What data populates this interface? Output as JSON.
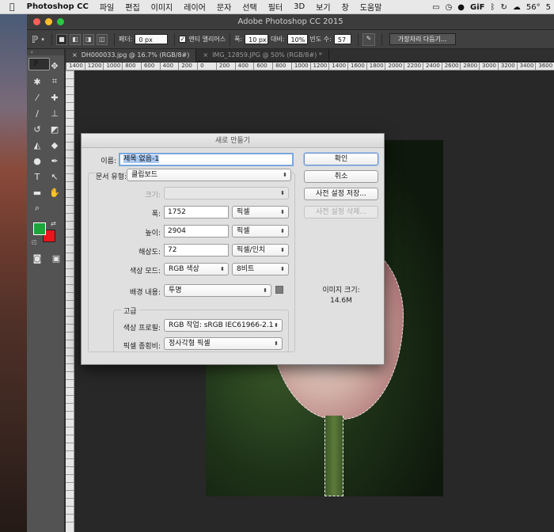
{
  "menubar": {
    "apple": "",
    "app": "Photoshop CC",
    "items": [
      "파일",
      "편집",
      "이미지",
      "레이어",
      "문자",
      "선택",
      "필터",
      "3D",
      "보기",
      "창",
      "도움말"
    ],
    "right": {
      "gif": "GiF",
      "temp": "56°",
      "extra": "5"
    }
  },
  "window": {
    "title": "Adobe Photoshop CC 2015"
  },
  "options": {
    "feather_label": "페더:",
    "feather_value": "0 px",
    "antialias_label": "앤티 앨리어스",
    "width_label": "폭:",
    "width_value": "10 px",
    "contrast_label": "대비:",
    "contrast_value": "10%",
    "frequency_label": "빈도 수:",
    "frequency_value": "57",
    "refine_button": "가장자리 다듬기..."
  },
  "tabs": [
    {
      "close": "×",
      "label": "DH000033.jpg @ 16.7% (RGB/8#)"
    },
    {
      "close": "×",
      "label": "IMG_12859.JPG @ 50% (RGB/8#) *"
    }
  ],
  "ruler_h": [
    "1400",
    "1200",
    "1000",
    "800",
    "600",
    "400",
    "200",
    "0",
    "200",
    "400",
    "600",
    "800",
    "1000",
    "1200",
    "1400",
    "1600",
    "1800",
    "2000",
    "2200",
    "2400",
    "2600",
    "2800",
    "3000",
    "3200",
    "3400",
    "3600"
  ],
  "dialog": {
    "title": "새로 만들기",
    "name_label": "이름:",
    "name_value": "제목 없음-1",
    "preset_label": "문서 유형:",
    "preset_value": "클립보드",
    "size_label": "크기:",
    "width_label": "폭:",
    "width_value": "1752",
    "width_unit": "픽셀",
    "height_label": "높이:",
    "height_value": "2904",
    "height_unit": "픽셀",
    "resolution_label": "해상도:",
    "resolution_value": "72",
    "resolution_unit": "픽셀/인치",
    "color_mode_label": "색상 모드:",
    "color_mode_value": "RGB 색상",
    "bit_depth_value": "8비트",
    "background_label": "배경 내용:",
    "background_value": "투명",
    "advanced_label": "고급",
    "profile_label": "색상 프로필:",
    "profile_value": "RGB 작업: sRGB IEC61966-2.1",
    "pixel_aspect_label": "픽셀 종횡비:",
    "pixel_aspect_value": "정사각형 픽셀",
    "ok_button": "확인",
    "cancel_button": "취소",
    "save_preset_button": "사전 설정 저장...",
    "delete_preset_button": "사전 설정 삭제...",
    "image_size_label": "이미지 크기:",
    "image_size_value": "14.6M"
  },
  "colors": {
    "foreground": "#1fa33a",
    "background": "#e8151b"
  }
}
